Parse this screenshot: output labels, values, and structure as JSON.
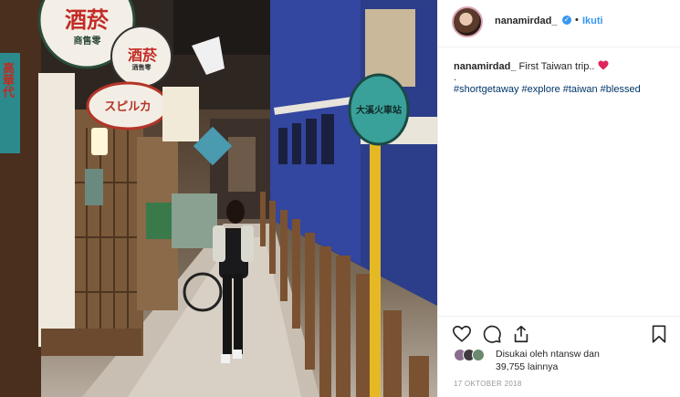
{
  "post": {
    "username": "nanamirdad_",
    "follow_label": "Ikuti",
    "dot_separator": "•",
    "caption_text": " First Taiwan trip..",
    "caption_dot": ".",
    "hashtags": [
      "#shortgetaway",
      "#explore",
      "#taiwan",
      "#blessed"
    ],
    "likes_line1": "Disukai oleh ntansw dan",
    "likes_line2": "39,755 lainnya",
    "date": "17 OKTOBER 2018"
  },
  "photo": {
    "signs": {
      "sake": "酒菸",
      "sake_small": "商售零",
      "sake2": "酒菸",
      "sake2_small": "酒售零",
      "supica": "スピルカ",
      "train_station": "大溪火車站",
      "katakana_left": "高華代"
    }
  },
  "icons": {
    "verified": "verified-badge-icon",
    "like": "heart-outline-icon",
    "comment": "comment-bubble-icon",
    "share": "share-upload-icon",
    "save": "bookmark-icon",
    "caption_heart": "red-heart-emoji"
  },
  "colors": {
    "link": "#3897f0",
    "hashtag": "#003569",
    "heart": "#e0245e",
    "muted": "#999999",
    "border": "#efefef"
  }
}
